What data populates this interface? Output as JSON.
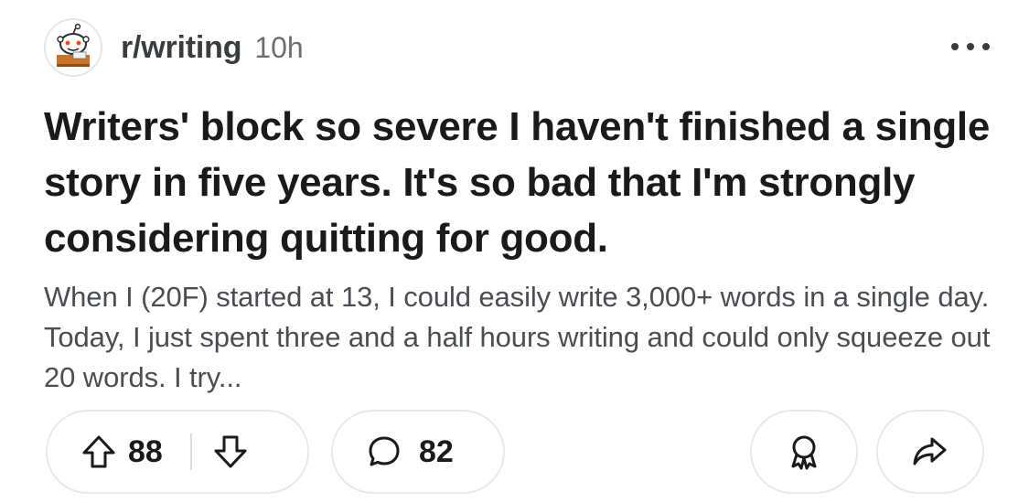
{
  "post": {
    "subreddit": "r/writing",
    "age": "10h",
    "title": "Writers' block so severe I haven't finished a single story in five years. It's so bad that I'm strongly considering quitting for good.",
    "body": "When I (20F) started at 13, I could easily write 3,000+ words in a single day. Today, I just spent three and a half hours writing and could only squeeze out 20 words. I try..."
  },
  "actions": {
    "upvotes": "88",
    "comments": "82"
  },
  "icons": {
    "avatar": "subreddit-avatar-icon",
    "more": "more-options-icon",
    "upvote": "upvote-arrow-icon",
    "downvote": "downvote-arrow-icon",
    "comment": "comment-bubble-icon",
    "award": "award-icon",
    "share": "share-arrow-icon"
  },
  "colors": {
    "text_primary": "#1a1a1b",
    "text_secondary": "#4a4e52",
    "meta": "#6b6f73",
    "border": "#e6e8ea"
  }
}
